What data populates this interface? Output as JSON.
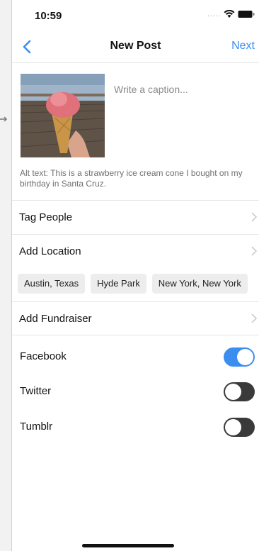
{
  "status_bar": {
    "time": "10:59",
    "signal_dots": "....."
  },
  "nav": {
    "title": "New Post",
    "next_label": "Next"
  },
  "post": {
    "caption_placeholder": "Write a caption...",
    "alt_text": "Alt text: This is a strawberry ice cream cone I bought on my birthday in Santa Cruz."
  },
  "rows": {
    "tag_people": "Tag People",
    "add_location": "Add Location",
    "add_fundraiser": "Add Fundraiser"
  },
  "location_chips": [
    "Austin, Texas",
    "Hyde Park",
    "New York, New York"
  ],
  "share": [
    {
      "label": "Facebook",
      "on": true
    },
    {
      "label": "Twitter",
      "on": false
    },
    {
      "label": "Tumblr",
      "on": false
    }
  ],
  "colors": {
    "accent": "#3b8ef0",
    "toggle_off": "#3a3a3a"
  }
}
